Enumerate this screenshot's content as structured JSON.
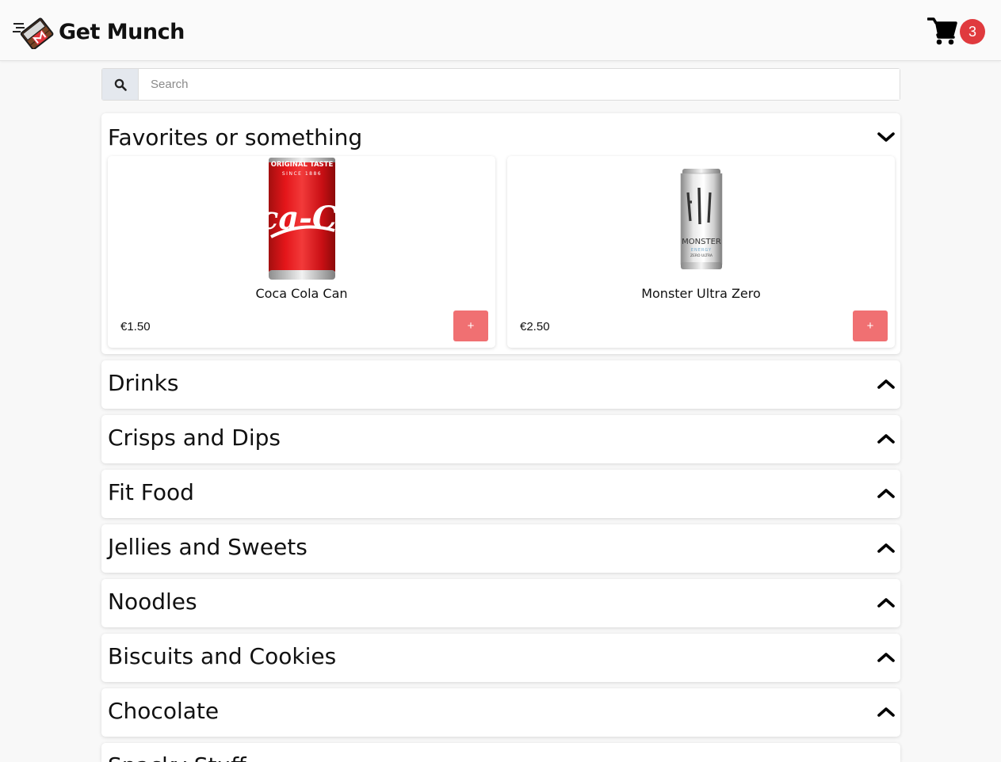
{
  "app": {
    "name": "Get Munch"
  },
  "cart": {
    "count": "3"
  },
  "search": {
    "placeholder": "Search",
    "value": ""
  },
  "favorites": {
    "title": "Favorites or something",
    "products": [
      {
        "name": "Coca Cola Can",
        "price": "€1.50",
        "add_label": "+"
      },
      {
        "name": "Monster Ultra Zero",
        "price": "€2.50",
        "add_label": "+"
      }
    ]
  },
  "categories": [
    {
      "title": "Drinks"
    },
    {
      "title": "Crisps and Dips"
    },
    {
      "title": "Fit Food"
    },
    {
      "title": "Jellies and Sweets"
    },
    {
      "title": "Noodles"
    },
    {
      "title": "Biscuits and Cookies"
    },
    {
      "title": "Chocolate"
    },
    {
      "title": "Snacky Stuff"
    }
  ],
  "icons": {
    "logo": "chocolate-bar-logo-icon",
    "cart": "shopping-cart-icon",
    "search": "search-icon",
    "collapse": "chevron-down-icon",
    "expand": "chevron-up-icon"
  },
  "colors": {
    "badge": "#e03a3e",
    "add_button": "#f07072",
    "search_addon": "#e4e8ee"
  }
}
